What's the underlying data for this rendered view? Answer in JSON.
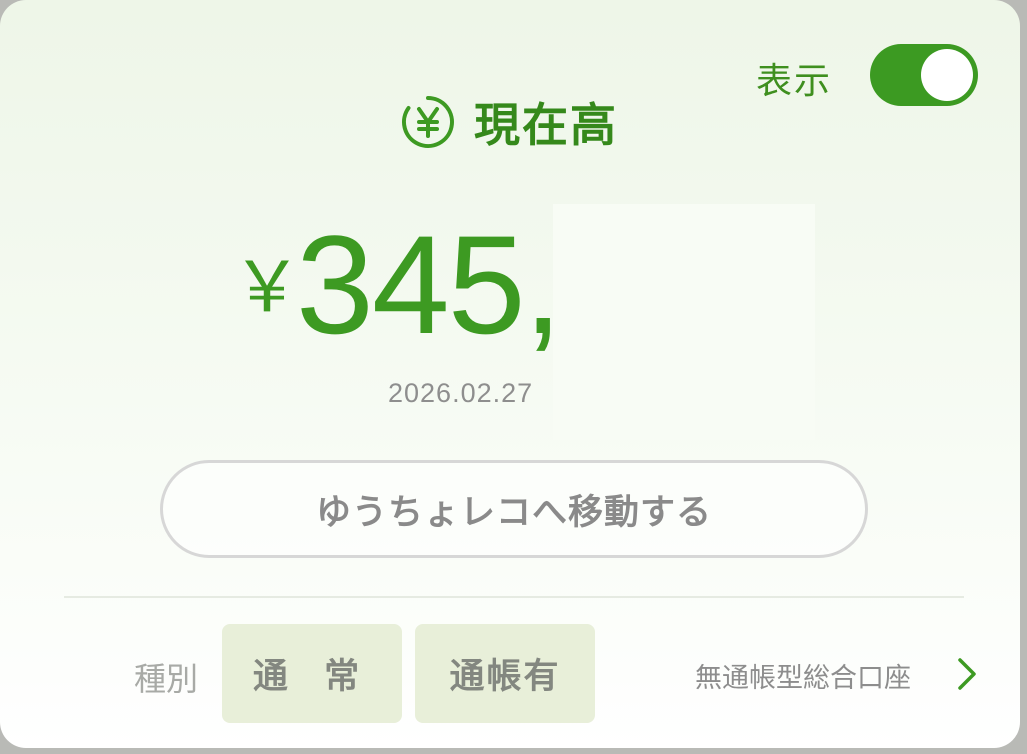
{
  "display_toggle": {
    "label": "表示",
    "on": true,
    "accent_color": "#3c9a22"
  },
  "balance": {
    "icon": "yen-circle-icon",
    "title": "現在高",
    "currency_symbol": "￥",
    "amount_visible": "345,",
    "date": "2026.02.27"
  },
  "move_button": {
    "label": "ゆうちょレコへ移動する"
  },
  "account": {
    "type_label": "種別",
    "tags": [
      "通 常",
      "通帳有"
    ],
    "account_type": "無通帳型総合口座",
    "chevron_icon": "chevron-right-icon"
  }
}
